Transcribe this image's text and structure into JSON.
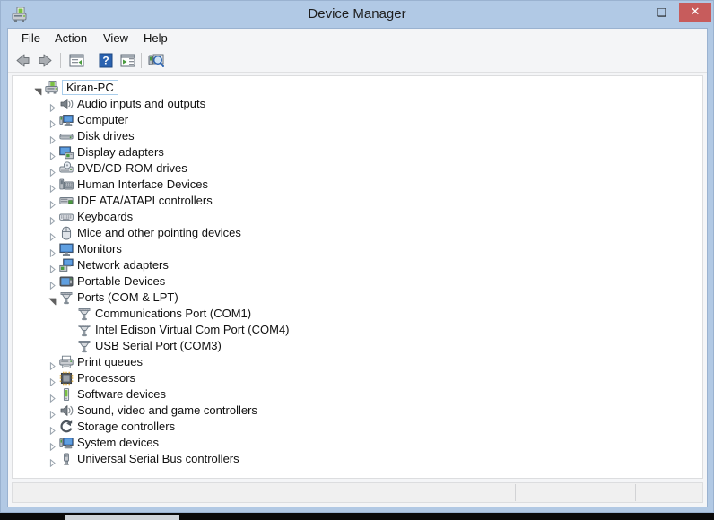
{
  "window": {
    "title": "Device Manager",
    "icon": "device-manager-icon",
    "controls": {
      "minimize": "–",
      "maximize": "❑",
      "close": "✕"
    }
  },
  "menubar": {
    "items": [
      {
        "label": "File"
      },
      {
        "label": "Action"
      },
      {
        "label": "View"
      },
      {
        "label": "Help"
      }
    ]
  },
  "toolbar": {
    "buttons": [
      {
        "name": "back-button",
        "icon": "back-arrow-icon"
      },
      {
        "name": "forward-button",
        "icon": "forward-arrow-icon"
      },
      {
        "name": "properties-button",
        "icon": "properties-icon"
      },
      {
        "name": "help-button",
        "icon": "help-question-icon"
      },
      {
        "name": "scan-hardware-button",
        "icon": "scan-list-icon"
      },
      {
        "name": "update-driver-button",
        "icon": "update-driver-scan-icon"
      }
    ]
  },
  "tree": {
    "root": {
      "label": "Kiran-PC",
      "icon": "computer-root-icon",
      "expanded": true,
      "selected": true
    },
    "nodes": [
      {
        "label": "Audio inputs and outputs",
        "icon": "speaker-icon",
        "expanded": false,
        "level": 1
      },
      {
        "label": "Computer",
        "icon": "computer-icon",
        "expanded": false,
        "level": 1
      },
      {
        "label": "Disk drives",
        "icon": "disk-drive-icon",
        "expanded": false,
        "level": 1
      },
      {
        "label": "Display adapters",
        "icon": "display-adapter-icon",
        "expanded": false,
        "level": 1
      },
      {
        "label": "DVD/CD-ROM drives",
        "icon": "dvd-drive-icon",
        "expanded": false,
        "level": 1
      },
      {
        "label": "Human Interface Devices",
        "icon": "hid-icon",
        "expanded": false,
        "level": 1
      },
      {
        "label": "IDE ATA/ATAPI controllers",
        "icon": "ide-controller-icon",
        "expanded": false,
        "level": 1
      },
      {
        "label": "Keyboards",
        "icon": "keyboard-icon",
        "expanded": false,
        "level": 1
      },
      {
        "label": "Mice and other pointing devices",
        "icon": "mouse-icon",
        "expanded": false,
        "level": 1
      },
      {
        "label": "Monitors",
        "icon": "monitor-icon",
        "expanded": false,
        "level": 1
      },
      {
        "label": "Network adapters",
        "icon": "network-adapter-icon",
        "expanded": false,
        "level": 1
      },
      {
        "label": "Portable Devices",
        "icon": "portable-device-icon",
        "expanded": false,
        "level": 1
      },
      {
        "label": "Ports (COM & LPT)",
        "icon": "port-icon",
        "expanded": true,
        "level": 1
      },
      {
        "label": "Communications Port (COM1)",
        "icon": "port-icon",
        "expanded": null,
        "level": 2
      },
      {
        "label": "Intel Edison Virtual Com Port (COM4)",
        "icon": "port-icon",
        "expanded": null,
        "level": 2
      },
      {
        "label": "USB Serial Port (COM3)",
        "icon": "port-icon",
        "expanded": null,
        "level": 2
      },
      {
        "label": "Print queues",
        "icon": "printer-icon",
        "expanded": false,
        "level": 1
      },
      {
        "label": "Processors",
        "icon": "processor-icon",
        "expanded": false,
        "level": 1
      },
      {
        "label": "Software devices",
        "icon": "software-device-icon",
        "expanded": false,
        "level": 1
      },
      {
        "label": "Sound, video and game controllers",
        "icon": "speaker-icon",
        "expanded": false,
        "level": 1
      },
      {
        "label": "Storage controllers",
        "icon": "storage-controller-icon",
        "expanded": false,
        "level": 1
      },
      {
        "label": "System devices",
        "icon": "computer-icon",
        "expanded": false,
        "level": 1
      },
      {
        "label": "Universal Serial Bus controllers",
        "icon": "usb-icon",
        "expanded": false,
        "level": 1
      }
    ]
  },
  "statusbar": {
    "panes": [
      "",
      "",
      ""
    ]
  },
  "colors": {
    "titlebar": "#b1c9e5",
    "close_button": "#c75c5c",
    "window_frame": "#9ab2d0",
    "client_background": "#f4f5f7",
    "tree_background": "#ffffff",
    "text": "#101010",
    "focus_outline": "#a9cdeb"
  }
}
